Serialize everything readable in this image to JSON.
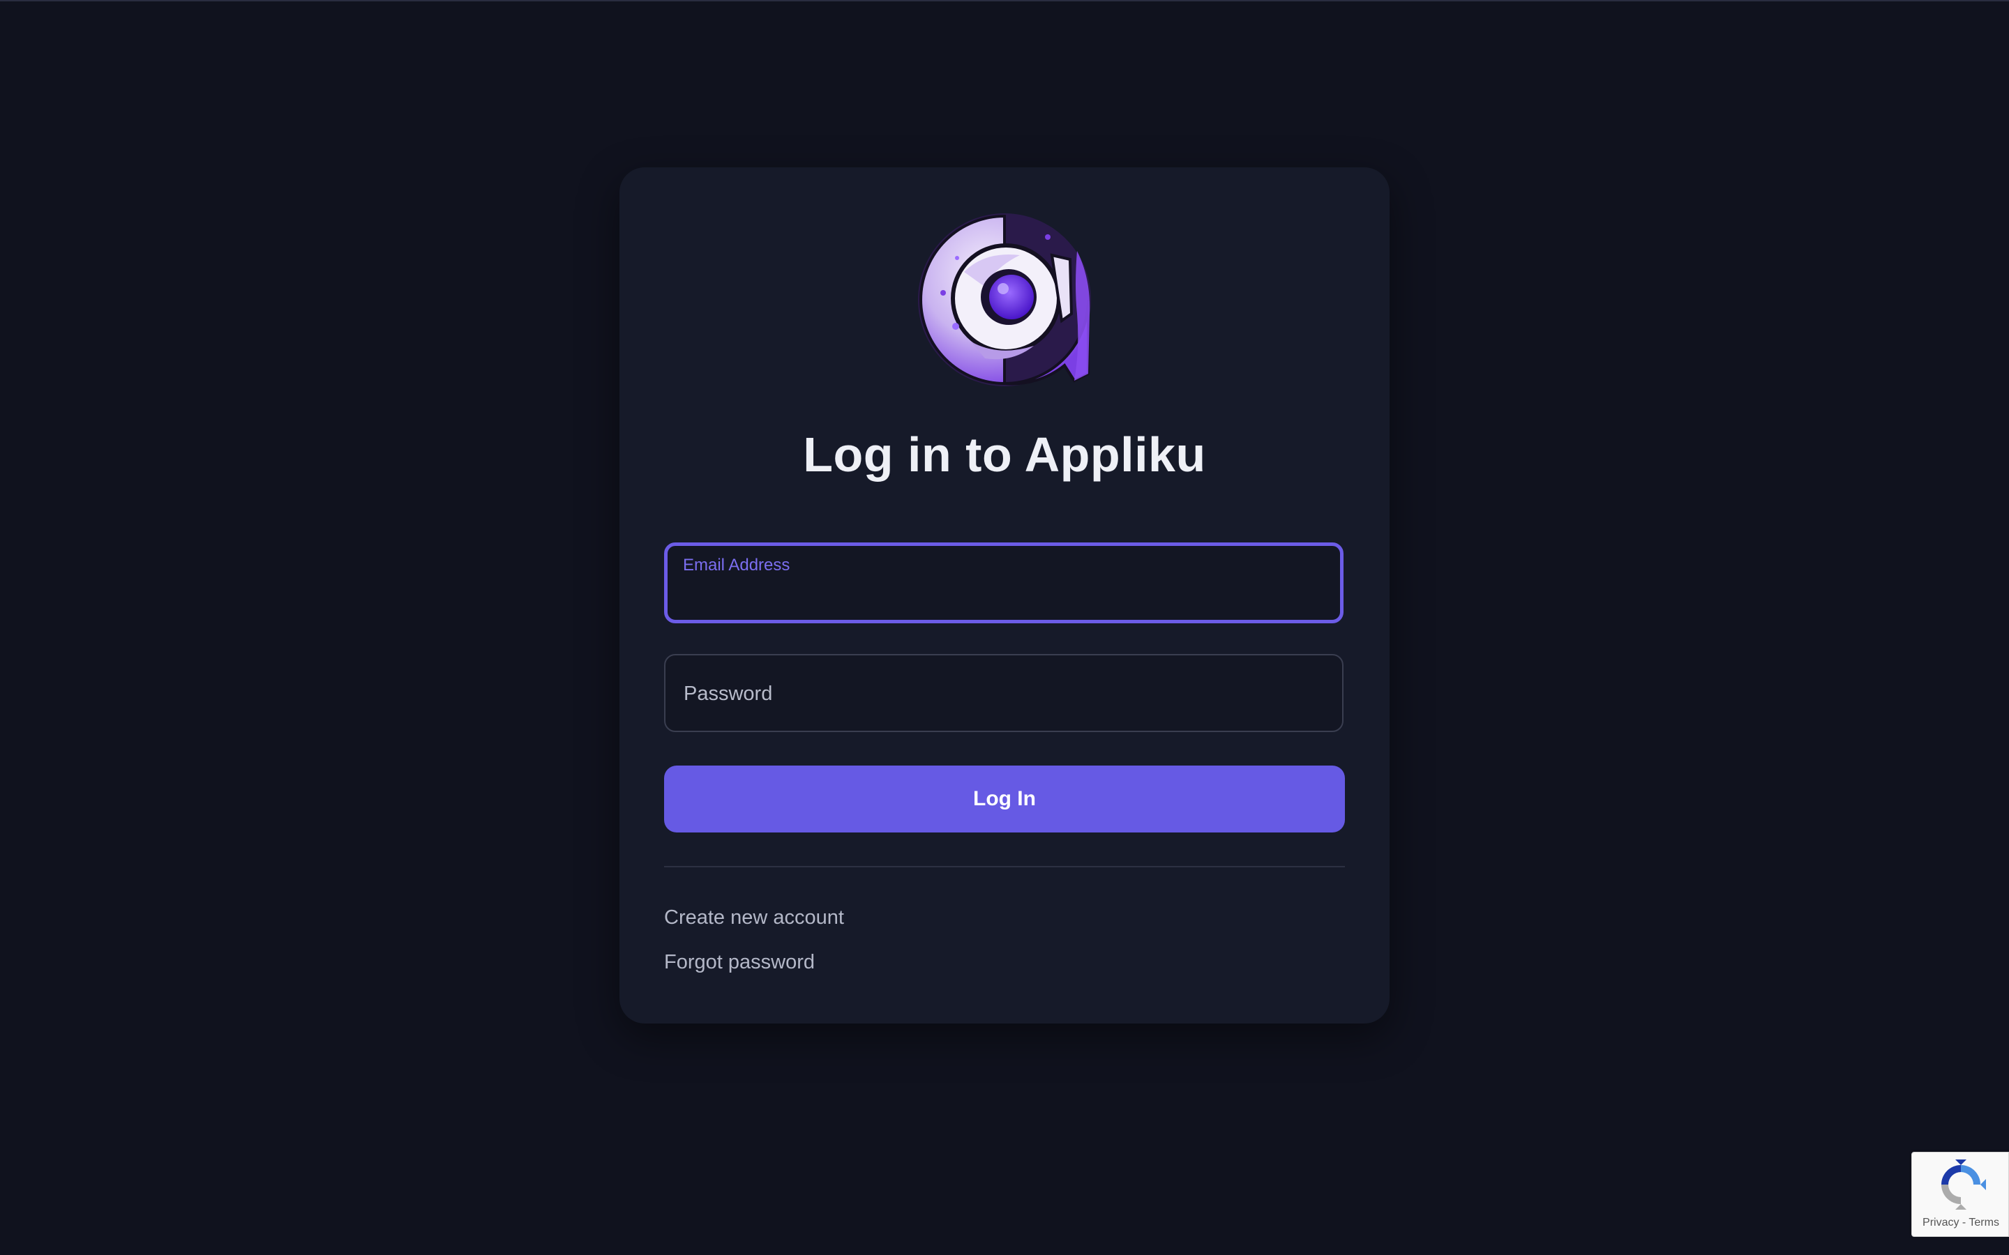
{
  "page": {
    "title": "Log in to Appliku",
    "logo_icon": "appliku-logo-icon"
  },
  "form": {
    "email_label": "Email Address",
    "email_value": "",
    "password_placeholder": "Password",
    "password_value": "",
    "submit_label": "Log In"
  },
  "links": {
    "create_account": "Create new account",
    "forgot_password": "Forgot password"
  },
  "recaptcha": {
    "icon": "recaptcha-icon",
    "privacy": "Privacy",
    "separator": " - ",
    "terms": "Terms"
  },
  "colors": {
    "background": "#10121e",
    "card": "#161a29",
    "accent": "#665ae4",
    "focus_border": "#6c5ce7"
  }
}
